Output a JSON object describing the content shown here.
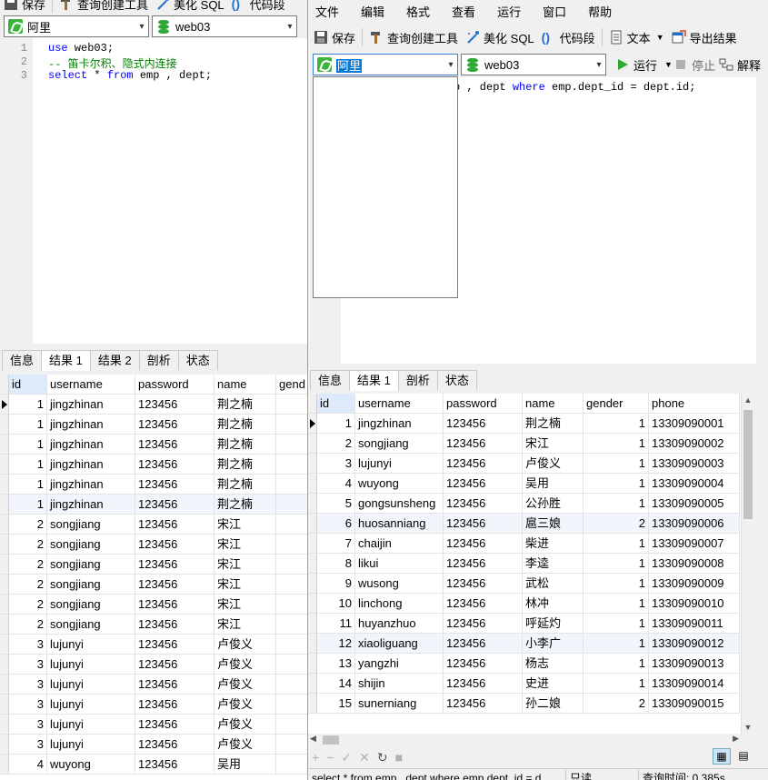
{
  "left": {
    "toolbar": {
      "save": "保存",
      "query_builder": "查询创建工具",
      "beautify": "美化 SQL",
      "snippet": "代码段"
    },
    "connection": "阿里",
    "database": "web03",
    "editor_lines": [
      {
        "num": "1",
        "parts": [
          {
            "t": "use",
            "c": "kw"
          },
          {
            "t": " web03;",
            "c": ""
          }
        ]
      },
      {
        "num": "2",
        "parts": [
          {
            "t": "-- 笛卡尔积、隐式内连接",
            "c": "cm"
          }
        ]
      },
      {
        "num": "3",
        "parts": [
          {
            "t": "select",
            "c": "kw"
          },
          {
            "t": " * ",
            "c": ""
          },
          {
            "t": "from",
            "c": "kw"
          },
          {
            "t": " emp , dept;",
            "c": ""
          }
        ]
      }
    ],
    "tabs": [
      "信息",
      "结果 1",
      "结果 2",
      "剖析",
      "状态"
    ],
    "columns": [
      "id",
      "username",
      "password",
      "name",
      "gend"
    ],
    "rows": [
      [
        "1",
        "jingzhinan",
        "123456",
        "荆之楠"
      ],
      [
        "1",
        "jingzhinan",
        "123456",
        "荆之楠"
      ],
      [
        "1",
        "jingzhinan",
        "123456",
        "荆之楠"
      ],
      [
        "1",
        "jingzhinan",
        "123456",
        "荆之楠"
      ],
      [
        "1",
        "jingzhinan",
        "123456",
        "荆之楠"
      ],
      [
        "1",
        "jingzhinan",
        "123456",
        "荆之楠"
      ],
      [
        "2",
        "songjiang",
        "123456",
        "宋江"
      ],
      [
        "2",
        "songjiang",
        "123456",
        "宋江"
      ],
      [
        "2",
        "songjiang",
        "123456",
        "宋江"
      ],
      [
        "2",
        "songjiang",
        "123456",
        "宋江"
      ],
      [
        "2",
        "songjiang",
        "123456",
        "宋江"
      ],
      [
        "2",
        "songjiang",
        "123456",
        "宋江"
      ],
      [
        "3",
        "lujunyi",
        "123456",
        "卢俊义"
      ],
      [
        "3",
        "lujunyi",
        "123456",
        "卢俊义"
      ],
      [
        "3",
        "lujunyi",
        "123456",
        "卢俊义"
      ],
      [
        "3",
        "lujunyi",
        "123456",
        "卢俊义"
      ],
      [
        "3",
        "lujunyi",
        "123456",
        "卢俊义"
      ],
      [
        "3",
        "lujunyi",
        "123456",
        "卢俊义"
      ],
      [
        "4",
        "wuyong",
        "123456",
        "吴用"
      ]
    ]
  },
  "right": {
    "menu": [
      "文件",
      "编辑",
      "格式",
      "查看",
      "运行",
      "窗口",
      "帮助"
    ],
    "toolbar": {
      "save": "保存",
      "query_builder": "查询创建工具",
      "beautify": "美化 SQL",
      "snippet": "代码段",
      "text": "文本",
      "export": "导出结果"
    },
    "connection": "阿里",
    "database": "web03",
    "run": "运行",
    "stop": "停止",
    "explain": "解释",
    "editor_visible": "p , dept where emp.dept_id = dept.id;",
    "tabs": [
      "信息",
      "结果 1",
      "剖析",
      "状态"
    ],
    "columns": [
      "id",
      "username",
      "password",
      "name",
      "gender",
      "phone"
    ],
    "rows": [
      [
        "1",
        "jingzhinan",
        "123456",
        "荆之楠",
        "1",
        "13309090001"
      ],
      [
        "2",
        "songjiang",
        "123456",
        "宋江",
        "1",
        "13309090002"
      ],
      [
        "3",
        "lujunyi",
        "123456",
        "卢俊义",
        "1",
        "13309090003"
      ],
      [
        "4",
        "wuyong",
        "123456",
        "吴用",
        "1",
        "13309090004"
      ],
      [
        "5",
        "gongsunsheng",
        "123456",
        "公孙胜",
        "1",
        "13309090005"
      ],
      [
        "6",
        "huosanniang",
        "123456",
        "扈三娘",
        "2",
        "13309090006"
      ],
      [
        "7",
        "chaijin",
        "123456",
        "柴进",
        "1",
        "13309090007"
      ],
      [
        "8",
        "likui",
        "123456",
        "李逵",
        "1",
        "13309090008"
      ],
      [
        "9",
        "wusong",
        "123456",
        "武松",
        "1",
        "13309090009"
      ],
      [
        "10",
        "linchong",
        "123456",
        "林冲",
        "1",
        "13309090010"
      ],
      [
        "11",
        "huyanzhuo",
        "123456",
        "呼延灼",
        "1",
        "13309090011"
      ],
      [
        "12",
        "xiaoliguang",
        "123456",
        "小李广",
        "1",
        "13309090012"
      ],
      [
        "13",
        "yangzhi",
        "123456",
        "杨志",
        "1",
        "13309090013"
      ],
      [
        "14",
        "shijin",
        "123456",
        "史进",
        "1",
        "13309090014"
      ],
      [
        "15",
        "sunerniang",
        "123456",
        "孙二娘",
        "2",
        "13309090015"
      ]
    ],
    "status": {
      "sql": "select * from emp , dept where emp.dept_id = d",
      "mode": "只读",
      "time": "查询时间: 0.385s"
    }
  }
}
